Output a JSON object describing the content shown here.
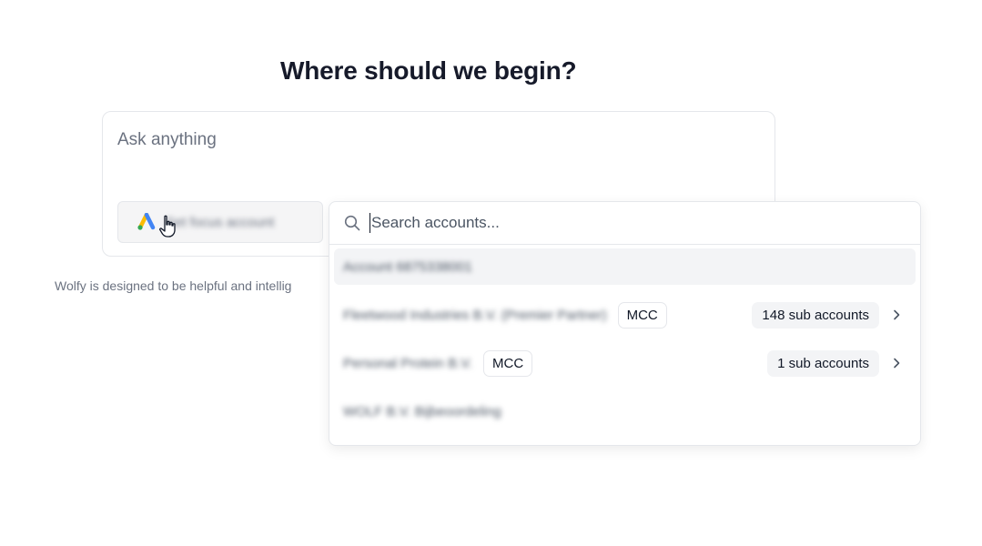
{
  "heading": "Where should we begin?",
  "composer": {
    "placeholder": "Ask anything",
    "account_button_label": "Set focus account"
  },
  "disclaimer": "Wolfy is designed to be helpful and intellig",
  "dropdown": {
    "search_placeholder": "Search accounts...",
    "accounts": [
      {
        "name": "Account 6875338001",
        "badge": "",
        "sub_accounts": ""
      },
      {
        "name": "Fleetwood Industries B.V. (Premier Partner)",
        "badge": "MCC",
        "sub_accounts": "148 sub accounts"
      },
      {
        "name": "Personal Protein B.V.",
        "badge": "MCC",
        "sub_accounts": "1 sub accounts"
      },
      {
        "name": "WOLF B.V. Bijbeoordeling",
        "badge": "",
        "sub_accounts": ""
      }
    ]
  },
  "icons": {
    "logo": "google-ads-icon",
    "search": "search-icon",
    "chevron": "chevron-right-icon",
    "cursor": "hand-pointer-icon"
  },
  "colors": {
    "heading": "#161a2a",
    "ads_blue": "#4285F4",
    "ads_yellow": "#FBBC04",
    "ads_green": "#34A853"
  }
}
